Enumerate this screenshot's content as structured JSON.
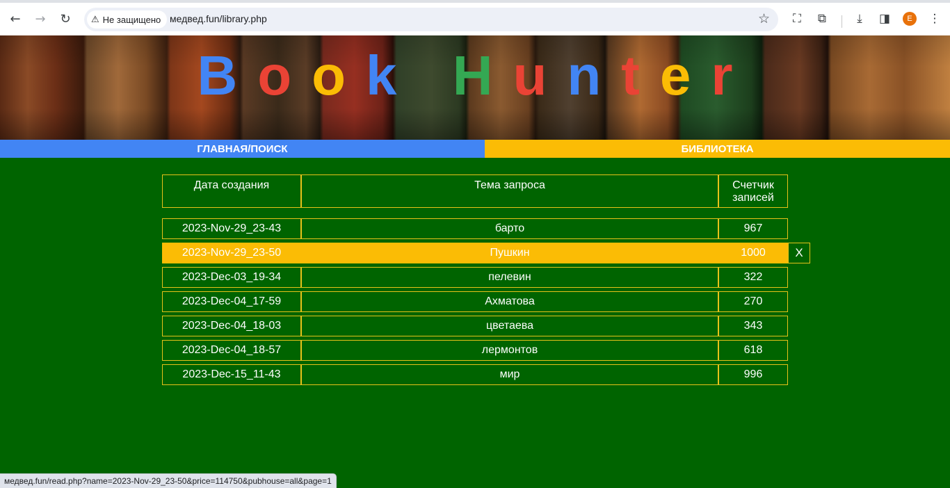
{
  "browser": {
    "security_label": "Не защищено",
    "url": "медвед.fun/library.php",
    "profile_initial": "E",
    "status_url": "медвед.fun/read.php?name=2023-Nov-29_23-50&price=114750&pubhouse=all&page=1"
  },
  "banner": {
    "letters": [
      {
        "char": "B",
        "color": "#4285f4"
      },
      {
        "char": "o",
        "color": "#ea4335"
      },
      {
        "char": "o",
        "color": "#fbbc05"
      },
      {
        "char": "k",
        "color": "#4285f4"
      },
      {
        "char": " ",
        "color": "#ffffff"
      },
      {
        "char": "H",
        "color": "#34a853"
      },
      {
        "char": "u",
        "color": "#ea4335"
      },
      {
        "char": "n",
        "color": "#4285f4"
      },
      {
        "char": "t",
        "color": "#ea4335"
      },
      {
        "char": "e",
        "color": "#fbbc05"
      },
      {
        "char": "r",
        "color": "#ea4335"
      }
    ]
  },
  "nav": {
    "home_label": "ГЛАВНАЯ/ПОИСК",
    "home_color": "#4285f4",
    "library_label": "БИБЛИОТЕКА",
    "library_color": "#fbbc05"
  },
  "table": {
    "headers": {
      "date": "Дата создания",
      "topic": "Тема запроса",
      "count_line1": "Счетчик",
      "count_line2": "записей"
    },
    "delete_label": "X",
    "rows": [
      {
        "date": "2023-Nov-29_23-43",
        "topic": "барто",
        "count": "967"
      },
      {
        "date": "2023-Nov-29_23-50",
        "topic": "Пушкин",
        "count": "1000"
      },
      {
        "date": "2023-Dec-03_19-34",
        "topic": "пелевин",
        "count": "322"
      },
      {
        "date": "2023-Dec-04_17-59",
        "topic": "Ахматова",
        "count": "270"
      },
      {
        "date": "2023-Dec-04_18-03",
        "topic": "цветаева",
        "count": "343"
      },
      {
        "date": "2023-Dec-04_18-57",
        "topic": "лермонтов",
        "count": "618"
      },
      {
        "date": "2023-Dec-15_11-43",
        "topic": "мир",
        "count": "996"
      }
    ]
  },
  "colors": {
    "page_bg": "#006400",
    "highlight": "#fbbc05",
    "border": "#e8c21a"
  }
}
